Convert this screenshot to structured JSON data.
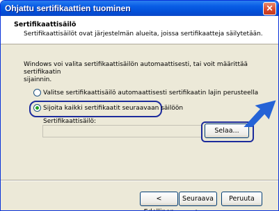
{
  "window": {
    "title": "Ohjattu sertifikaattien tuominen",
    "close_glyph": "✕"
  },
  "header": {
    "title": "Sertifikaattisäilö",
    "subtitle": "Sertifikaattisäilöt ovat järjestelmän alueita, joissa sertifikaatteja säilytetään."
  },
  "body": {
    "intro_line1": "Windows voi valita sertifikaattisäilön automaattisesti, tai voit määrittää sertifikaatin",
    "intro_line2": "sijainnin.",
    "option_auto": "Valitse sertifikaattisäilö automaattisesti sertifikaatin lajin perusteella",
    "option_manual": "Sijoita kaikki sertifikaatit seuraavaan säilöön",
    "selected_option": "option_manual",
    "store_label": "Sertifikaattisäilö:",
    "store_value": "",
    "browse_button": "Selaa..."
  },
  "footer": {
    "back_button": "< Edellinen",
    "next_button": "Seuraava >",
    "cancel_button": "Peruuta"
  },
  "colors": {
    "titlebar": "#0a5ee6",
    "highlight": "#1c2b9c",
    "arrow": "#2563d6"
  },
  "icons": {
    "close": "close-icon",
    "pointer_arrow": "arrow-icon"
  }
}
